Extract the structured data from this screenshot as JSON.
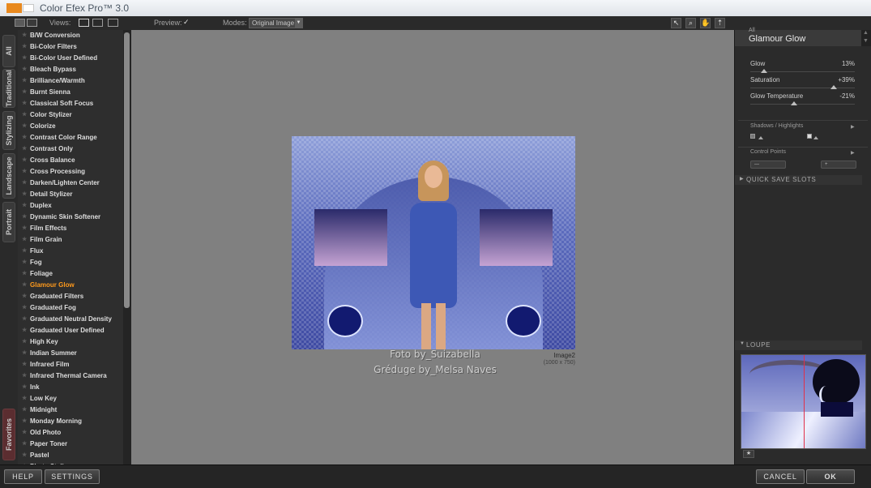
{
  "window": {
    "title": "Color Efex Pro™ 3.0"
  },
  "toolbar": {
    "views_label": "Views:",
    "preview_label": "Preview:",
    "preview_checked": "✓",
    "modes_label": "Modes:",
    "mode_value": "Original Image"
  },
  "left_tabs": [
    "All",
    "Traditional",
    "Stylizing",
    "Landscape",
    "Portrait",
    "Favorites"
  ],
  "filters": [
    "B/W Conversion",
    "Bi-Color Filters",
    "Bi-Color User Defined",
    "Bleach Bypass",
    "Brilliance/Warmth",
    "Burnt Sienna",
    "Classical Soft Focus",
    "Color Stylizer",
    "Colorize",
    "Contrast Color Range",
    "Contrast Only",
    "Cross Balance",
    "Cross Processing",
    "Darken/Lighten Center",
    "Detail Stylizer",
    "Duplex",
    "Dynamic Skin Softener",
    "Film Effects",
    "Film Grain",
    "Flux",
    "Fog",
    "Foliage",
    "Glamour Glow",
    "Graduated Filters",
    "Graduated Fog",
    "Graduated Neutral Density",
    "Graduated User Defined",
    "High Key",
    "Indian Summer",
    "Infrared Film",
    "Infrared Thermal Camera",
    "Ink",
    "Low Key",
    "Midnight",
    "Monday Morning",
    "Old Photo",
    "Paper Toner",
    "Pastel",
    "Photo Stylizer"
  ],
  "selected_filter": "Glamour Glow",
  "selected_color": "#ff9a1c",
  "preview": {
    "watermark_line1": "Foto by_Suizabella",
    "watermark_line2": "Gréduge by_Melsa Naves",
    "image_name": "Image2",
    "image_dims": "(1000 x 750)"
  },
  "panel": {
    "category": "All",
    "title": "Glamour Glow",
    "sliders": [
      {
        "label": "Glow",
        "value": "13%",
        "level": 0.13
      },
      {
        "label": "Saturation",
        "value": "+39%",
        "level": 0.8
      },
      {
        "label": "Glow Temperature",
        "value": "-21%",
        "level": 0.42
      }
    ],
    "shadows_label": "Shadows / Highlights",
    "control_points_label": "Control Points",
    "quick_save_label": "QUICK SAVE SLOTS",
    "loupe_label": "LOUPE"
  },
  "buttons": {
    "help": "HELP",
    "settings": "SETTINGS",
    "cancel": "CANCEL",
    "ok": "OK"
  }
}
